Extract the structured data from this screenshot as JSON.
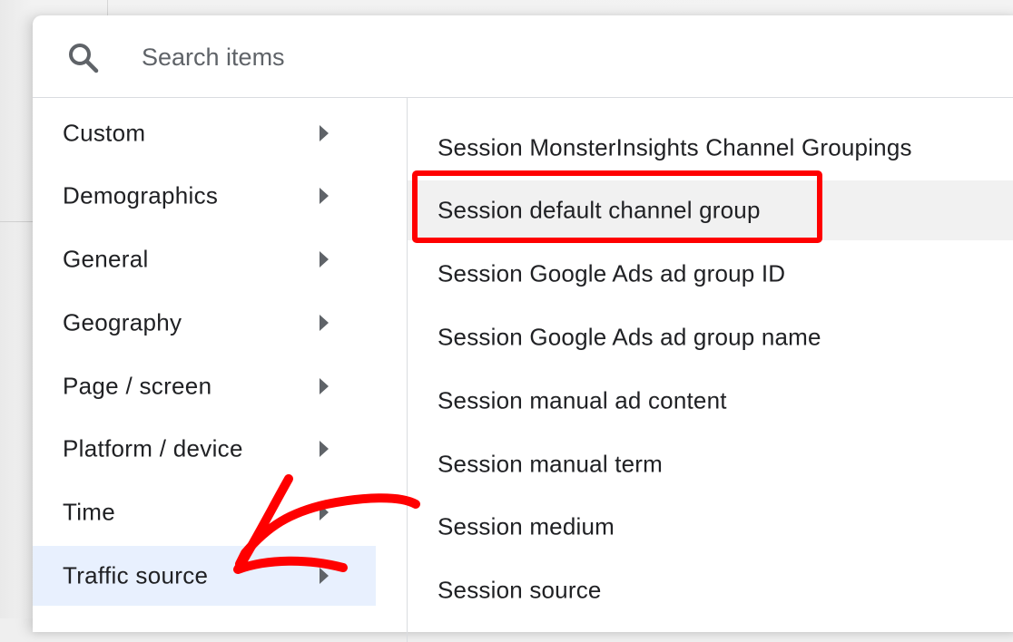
{
  "search": {
    "placeholder": "Search items",
    "value": "",
    "icon": "search-icon"
  },
  "categories": [
    {
      "label": "Custom",
      "icon": "chevron-right-icon",
      "active": false
    },
    {
      "label": "Demographics",
      "icon": "chevron-right-icon",
      "active": false
    },
    {
      "label": "General",
      "icon": "chevron-right-icon",
      "active": false
    },
    {
      "label": "Geography",
      "icon": "chevron-right-icon",
      "active": false
    },
    {
      "label": "Page / screen",
      "icon": "chevron-right-icon",
      "active": false
    },
    {
      "label": "Platform / device",
      "icon": "chevron-right-icon",
      "active": false
    },
    {
      "label": "Time",
      "icon": "chevron-right-icon",
      "active": false
    },
    {
      "label": "Traffic source",
      "icon": "chevron-right-icon",
      "active": true
    }
  ],
  "items": [
    {
      "label": "Session MonsterInsights Channel Groupings",
      "hovered": false
    },
    {
      "label": "Session default channel group",
      "hovered": true
    },
    {
      "label": "Session Google Ads ad group ID",
      "hovered": false
    },
    {
      "label": "Session Google Ads ad group name",
      "hovered": false
    },
    {
      "label": "Session manual ad content",
      "hovered": false
    },
    {
      "label": "Session manual term",
      "hovered": false
    },
    {
      "label": "Session medium",
      "hovered": false
    },
    {
      "label": "Session source",
      "hovered": false
    }
  ],
  "annotations": {
    "highlight_target": "Session default channel group",
    "arrow_target": "Traffic source",
    "color": "#ff0000"
  },
  "colors": {
    "active_category_bg": "#e8f0fe",
    "hover_item_bg": "#f1f1f1",
    "text": "#202124",
    "icon": "#5f6368"
  }
}
